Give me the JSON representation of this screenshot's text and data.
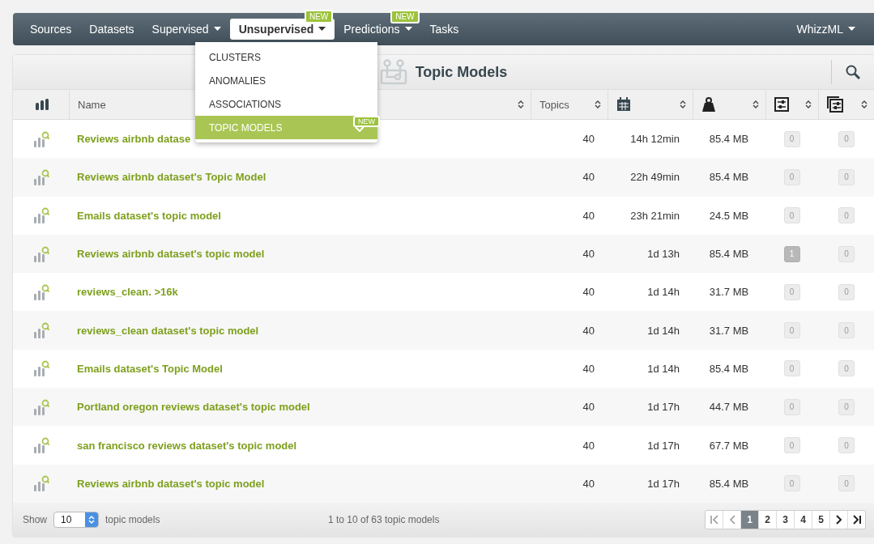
{
  "nav": {
    "items": [
      {
        "label": "Sources",
        "selected": false,
        "dropdown": false
      },
      {
        "label": "Datasets",
        "selected": false,
        "dropdown": false
      },
      {
        "label": "Supervised",
        "selected": false,
        "dropdown": true
      },
      {
        "label": "Unsupervised",
        "selected": true,
        "dropdown": true,
        "badge": "NEW"
      },
      {
        "label": "Predictions",
        "selected": false,
        "dropdown": true,
        "badge": "NEW"
      },
      {
        "label": "Tasks",
        "selected": false,
        "dropdown": false
      }
    ],
    "right": {
      "label": "WhizzML"
    }
  },
  "menu": {
    "items": [
      {
        "label": "CLUSTERS",
        "selected": false
      },
      {
        "label": "ANOMALIES",
        "selected": false
      },
      {
        "label": "ASSOCIATIONS",
        "selected": false
      },
      {
        "label": "TOPIC MODELS",
        "selected": true,
        "badge": "NEW"
      }
    ]
  },
  "panel": {
    "title": "Topic Models"
  },
  "table": {
    "columns": [
      {
        "kind": "icon"
      },
      {
        "kind": "text",
        "label": "Name"
      },
      {
        "kind": "text",
        "label": "Topics"
      },
      {
        "kind": "calendar"
      },
      {
        "kind": "weight"
      },
      {
        "kind": "sliders"
      },
      {
        "kind": "multi-sliders"
      }
    ],
    "rows": [
      {
        "name": "Reviews airbnb datase",
        "topics": "40",
        "age": "14h 12min",
        "size": "85.4 MB",
        "count_1": "0",
        "count_2": "0"
      },
      {
        "name": "Reviews airbnb dataset's Topic Model",
        "topics": "40",
        "age": "22h 49min",
        "size": "85.4 MB",
        "count_1": "0",
        "count_2": "0"
      },
      {
        "name": "Emails dataset's topic model",
        "topics": "40",
        "age": "23h 21min",
        "size": "24.5 MB",
        "count_1": "0",
        "count_2": "0"
      },
      {
        "name": "Reviews airbnb dataset's topic model",
        "topics": "40",
        "age": "1d 13h",
        "size": "85.4 MB",
        "count_1": "1",
        "count_2": "0"
      },
      {
        "name": "reviews_clean. >16k",
        "topics": "40",
        "age": "1d 14h",
        "size": "31.7 MB",
        "count_1": "0",
        "count_2": "0"
      },
      {
        "name": "reviews_clean dataset's topic model",
        "topics": "40",
        "age": "1d 14h",
        "size": "31.7 MB",
        "count_1": "0",
        "count_2": "0"
      },
      {
        "name": "Emails dataset's Topic Model",
        "topics": "40",
        "age": "1d 14h",
        "size": "85.4 MB",
        "count_1": "0",
        "count_2": "0"
      },
      {
        "name": "Portland oregon reviews dataset's topic model",
        "topics": "40",
        "age": "1d 17h",
        "size": "44.7 MB",
        "count_1": "0",
        "count_2": "0"
      },
      {
        "name": "san francisco reviews dataset's topic model",
        "topics": "40",
        "age": "1d 17h",
        "size": "67.7 MB",
        "count_1": "0",
        "count_2": "0"
      },
      {
        "name": "Reviews airbnb dataset's topic model",
        "topics": "40",
        "age": "1d 17h",
        "size": "85.4 MB",
        "count_1": "0",
        "count_2": "0"
      }
    ]
  },
  "footer": {
    "show_label": "Show",
    "page_size": "10",
    "unit_label": "topic models",
    "summary": "1 to 10 of 63 topic models",
    "pages": [
      {
        "label": "1",
        "selected": true
      },
      {
        "label": "2",
        "selected": false
      },
      {
        "label": "3",
        "selected": false
      },
      {
        "label": "4",
        "selected": false
      },
      {
        "label": "5",
        "selected": false
      }
    ]
  }
}
